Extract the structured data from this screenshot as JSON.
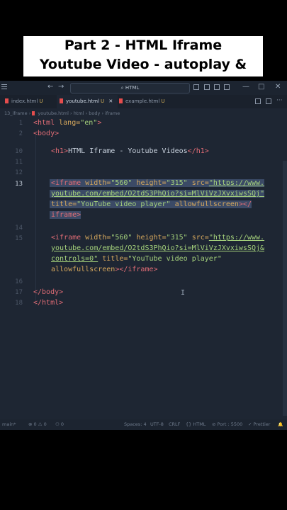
{
  "banner": {
    "line1": "Part 2 - HTML Iframe",
    "line2": "Youtube Video - autoplay & mute"
  },
  "titlebar": {
    "search_text": "HTML",
    "back": "←",
    "forward": "→",
    "minimize": "—",
    "maximize": "□",
    "close": "✕"
  },
  "tabs": [
    {
      "label": "index.html",
      "mark": "U"
    },
    {
      "label": "youtube.html",
      "mark": "U",
      "close": "✕"
    },
    {
      "label": "example.html",
      "mark": "U"
    }
  ],
  "breadcrumb": [
    "13_iframe",
    "youtube.html",
    "html",
    "body",
    "iframe"
  ],
  "lines": [
    {
      "n": "1"
    },
    {
      "n": "2"
    },
    {
      "n": "10"
    },
    {
      "n": "11"
    },
    {
      "n": "12"
    },
    {
      "n": "13"
    },
    {
      "n": "14"
    },
    {
      "n": "15"
    },
    {
      "n": "16"
    },
    {
      "n": "17"
    },
    {
      "n": "18"
    }
  ],
  "code": {
    "l1_tag": "<html",
    "l1_attr": " lang=",
    "l1_str": "\"en\"",
    "l1_end": ">",
    "l2": "<body>",
    "l10_open": "<h1>",
    "l10_text": "HTML Iframe - Youtube Videos",
    "l10_close": "</h1>",
    "l13_a_tag": "<iframe",
    "l13_a_attr1": " width=",
    "l13_a_str1": "\"560\"",
    "l13_a_attr2": " height=",
    "l13_a_str2": "\"315\"",
    "l13_a_attr3": " src=",
    "l13_a_str3": "\"https://www.",
    "l13_b": "youtube.com/embed/O2tdS3PhQio?si=MlViVzJXvxiwsSQj\"",
    "l13_c_attr1": "title=",
    "l13_c_str1": "\"YouTube video player\"",
    "l13_c_attr2": " allowfullscreen",
    "l13_c_tag": "></",
    "l13_d": "iframe>",
    "l15_a_tag": "<iframe",
    "l15_a_attr1": " width=",
    "l15_a_str1": "\"560\"",
    "l15_a_attr2": " height=",
    "l15_a_str2": "\"315\"",
    "l15_a_attr3": " src=",
    "l15_a_str3": "\"https://www.",
    "l15_b": "youtube.com/embed/O2tdS3PhQio?si=MlViVzJXvxiwsSQj&",
    "l15_c_url": "controls=0\"",
    "l15_c_attr": " title=",
    "l15_c_str": "\"YouTube video player\"",
    "l15_d_attr": "allowfullscreen",
    "l15_d_tag": "></iframe>",
    "l17": "</body>",
    "l18": "</html>"
  },
  "status": {
    "branch": "main*",
    "problems": "⊗ 0 ⚠ 0",
    "ports": "⚇ 0",
    "spaces": "Spaces: 4",
    "encoding": "UTF-8",
    "eol": "CRLF",
    "lang": "{} HTML",
    "port": "⊘ Port : 5500",
    "prettier": "✓ Prettier",
    "bell": "🔔"
  },
  "colors": {
    "tag": "#e06c75",
    "attr": "#d7a85d",
    "string": "#a6d37c",
    "editor_bg": "#1e2633",
    "selection": "#3b4a66"
  }
}
